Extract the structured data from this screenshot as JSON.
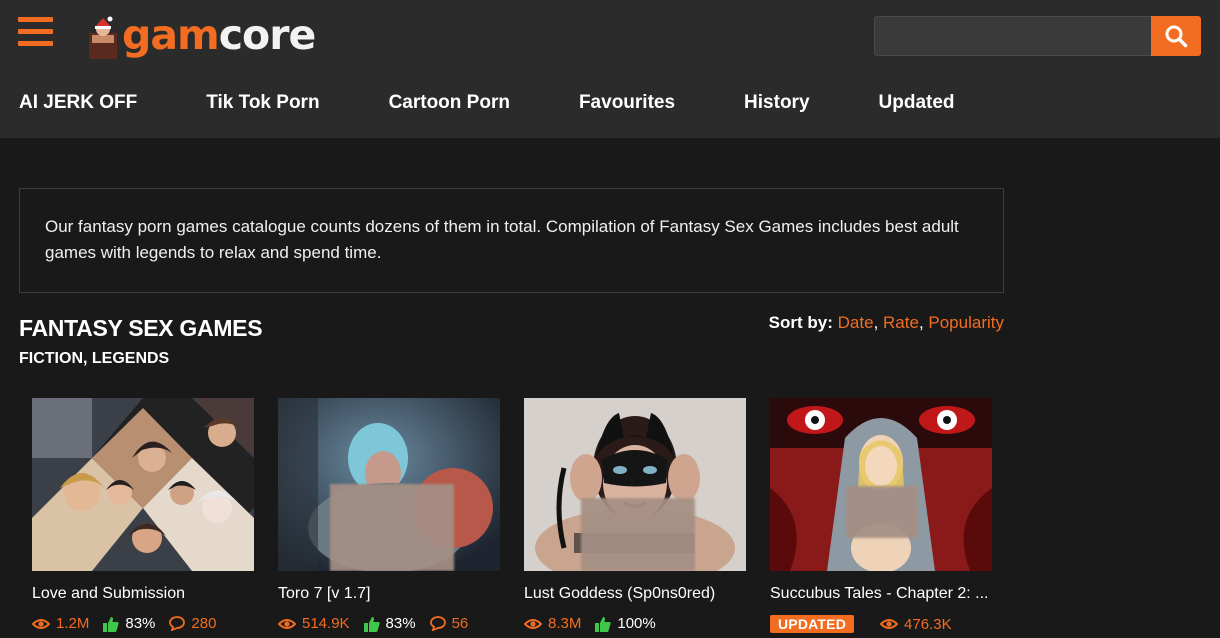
{
  "brand": {
    "name_part1": "gam",
    "name_part2": "core"
  },
  "search": {
    "placeholder": "",
    "value": ""
  },
  "nav": [
    "AI JERK OFF",
    "Tik Tok Porn",
    "Cartoon Porn",
    "Favourites",
    "History",
    "Updated"
  ],
  "intro": "Our fantasy porn games catalogue counts dozens of them in total. Compilation of Fantasy Sex Games includes best adult games with legends to relax and spend time.",
  "page_title": "FANTASY SEX GAMES",
  "page_subtitle": "FICTION, LEGENDS",
  "sort": {
    "label": "Sort by:",
    "options": [
      "Date",
      "Rate",
      "Popularity"
    ]
  },
  "colors": {
    "accent": "#f26d21",
    "header_bg": "#2b2b2b",
    "page_bg": "#191919",
    "like_green": "#3ec74a"
  },
  "games": [
    {
      "title": "Love and Submission",
      "views": "1.2M",
      "rating": "83%",
      "comments": "280",
      "badge": ""
    },
    {
      "title": "Toro 7 [v 1.7]",
      "views": "514.9K",
      "rating": "83%",
      "comments": "56",
      "badge": ""
    },
    {
      "title": "Lust Goddess (Sp0ns0red)",
      "views": "8.3M",
      "rating": "100%",
      "comments": "",
      "badge": ""
    },
    {
      "title": "Succubus Tales - Chapter 2: ...",
      "views": "476.3K",
      "rating": "",
      "comments": "",
      "badge": "UPDATED"
    }
  ]
}
